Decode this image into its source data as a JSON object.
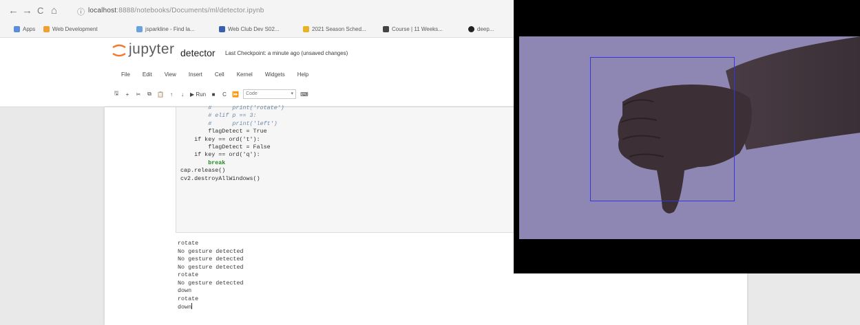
{
  "browser": {
    "nav": {
      "back": "←",
      "forward": "→",
      "reload": "C",
      "home": "⌂"
    },
    "address_host": "localhost",
    "address_rest": ":8888/notebooks/Documents/ml/detector.ipynb",
    "bookmarks": [
      {
        "label": "Apps",
        "icon_color": "#5b8dd9"
      },
      {
        "label": "Web Development",
        "icon_color": "#f0a030"
      },
      {
        "label": "jsparkline - Find la...",
        "icon_color": "#6aa2e0"
      },
      {
        "label": "Web Club Dev S02...",
        "icon_color": "#3a5fb0"
      },
      {
        "label": "2021 Season Sched...",
        "icon_color": "#e6b422"
      },
      {
        "label": "Course | 11 Weeks...",
        "icon_color": "#444444"
      },
      {
        "label": "deep...",
        "icon_color": "#222222"
      }
    ]
  },
  "jupyter": {
    "logo_text": "jupyter",
    "notebook_name": "detector",
    "checkpoint": "Last Checkpoint: a minute ago (unsaved changes)",
    "menu": [
      "File",
      "Edit",
      "View",
      "Insert",
      "Cell",
      "Kernel",
      "Widgets",
      "Help"
    ],
    "toolbar": {
      "save": "🖫",
      "add": "+",
      "cut": "✂",
      "copy": "⧉",
      "paste": "📋",
      "up": "↑",
      "down": "↓",
      "run": "▶ Run",
      "stop": "■",
      "restart": "C",
      "ff": "⏩",
      "cell_type": "Code",
      "keyboard": "⌨"
    }
  },
  "code_lines": [
    "        #      print('rotate')",
    "        # elif p == 3:",
    "        #      print('left')",
    "        flagDetect = True",
    "",
    "    if key == ord('t'):",
    "        flagDetect = False",
    "",
    "    if key == ord('q'):",
    "        break",
    "",
    "cap.release()",
    "cv2.destroyAllWindows()"
  ],
  "output_lines": [
    "rotate",
    "No gesture detected",
    "No gesture detected",
    "No gesture detected",
    "rotate",
    "No gesture detected",
    "down",
    "rotate",
    "down"
  ],
  "colors": {
    "camera_background": "#8e87b3",
    "detection_box": "#3636e0",
    "code_keyword": "#1f8a1f",
    "code_comment": "#6a8aa8"
  }
}
